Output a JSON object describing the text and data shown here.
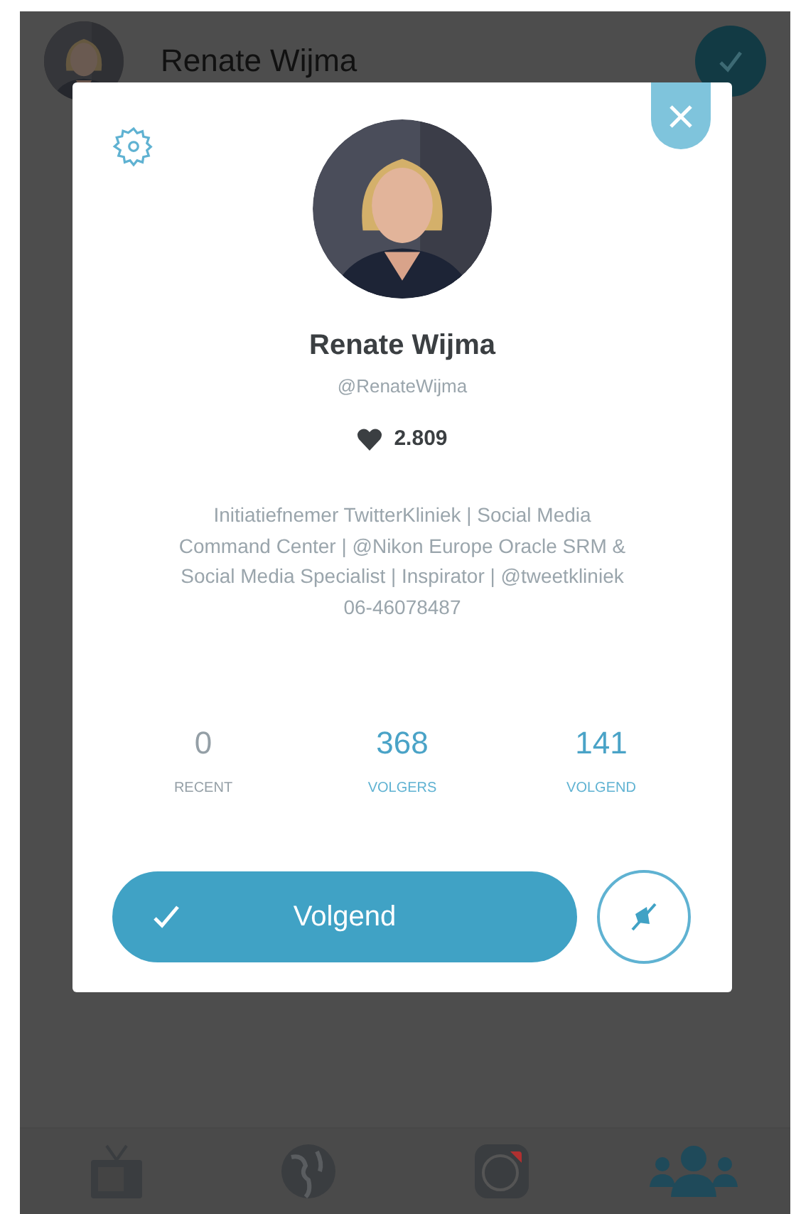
{
  "header": {
    "name": "Renate Wijma",
    "following": true
  },
  "profile": {
    "name": "Renate Wijma",
    "handle": "@RenateWijma",
    "likes": "2.809",
    "bio": "Initiatiefnemer TwitterKliniek | Social Media Command Center | @Nikon Europe Oracle SRM & Social Media Specialist | Inspirator | @tweetkliniek 06-46078487"
  },
  "stats": [
    {
      "value": "0",
      "label": "RECENT",
      "active": false
    },
    {
      "value": "368",
      "label": "VOLGERS",
      "active": true
    },
    {
      "value": "141",
      "label": "VOLGEND",
      "active": true
    }
  ],
  "follow_button": {
    "label": "Volgend",
    "following": true
  },
  "tabs": [
    {
      "kind": "tv",
      "selected": false
    },
    {
      "kind": "globe",
      "selected": false
    },
    {
      "kind": "camera",
      "selected": false,
      "badge": true
    },
    {
      "kind": "people",
      "selected": true
    }
  ]
}
